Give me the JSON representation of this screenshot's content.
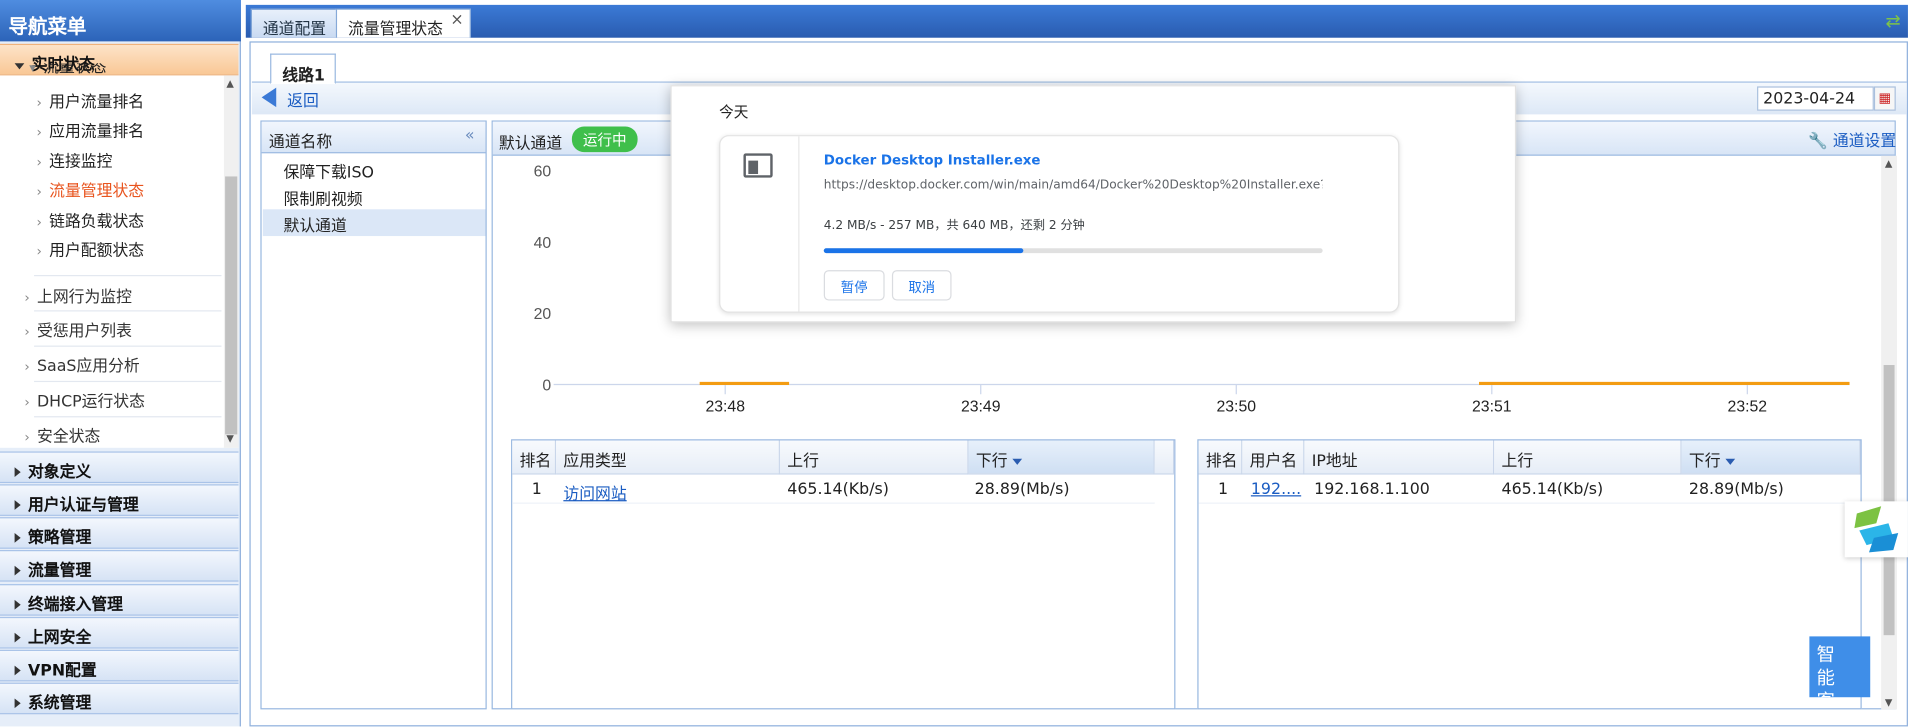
{
  "nav": {
    "title": "导航菜单",
    "collapse_icon": "«",
    "live_group": "实时状态",
    "partial_item": "流量状态",
    "sub_items": [
      "用户流量排名",
      "应用流量排名",
      "连接监控",
      "流量管理状态",
      "链路负载状态",
      "用户配额状态"
    ],
    "active_sub": "流量管理状态",
    "sections": [
      "上网行为监控",
      "受惩用户列表",
      "SaaS应用分析",
      "DHCP运行状态",
      "安全状态"
    ],
    "groups": [
      "对象定义",
      "用户认证与管理",
      "策略管理",
      "流量管理",
      "终端接入管理",
      "上网安全",
      "VPN配置",
      "系统管理"
    ]
  },
  "tabs": {
    "items": [
      "通道配置",
      "流量管理状态"
    ],
    "active": "流量管理状态",
    "close_glyph": "×",
    "refresh_glyph": "⇄"
  },
  "line_tab": "线路1",
  "back_label": "返回",
  "date_value": "2023-04-24",
  "channels": {
    "header": "通道名称",
    "items": [
      "保障下载ISO",
      "限制刷视频",
      "默认通道"
    ],
    "selected": "默认通道"
  },
  "chart_panel": {
    "title": "默认通道",
    "status": "运行中",
    "setting_label": "通道设置"
  },
  "chart_data": {
    "type": "line",
    "x_tick_labels": [
      "23:48",
      "23:49",
      "23:50",
      "23:51",
      "23:52"
    ],
    "y_ticks": [
      0,
      20,
      40,
      60
    ],
    "ylim": [
      0,
      60
    ],
    "series": [
      {
        "color": "#f39c12",
        "x": [
          "23:47.9",
          "23:48.25"
        ],
        "y": [
          0.3,
          0.3
        ]
      },
      {
        "color": "#f39c12",
        "x": [
          "23:50.95",
          "23:52.4"
        ],
        "y": [
          0.3,
          0.3
        ]
      }
    ],
    "grid": false
  },
  "app_table": {
    "headers": [
      "排名",
      "应用类型",
      "上行",
      "下行"
    ],
    "rows": [
      {
        "rank": "1",
        "name": "访问网站",
        "up": "465.14(Kb/s)",
        "down": "28.89(Mb/s)"
      }
    ]
  },
  "user_table": {
    "headers": [
      "排名",
      "用户名",
      "IP地址",
      "上行",
      "下行"
    ],
    "rows": [
      {
        "rank": "1",
        "user": "192....",
        "ip": "192.168.1.100",
        "up": "465.14(Kb/s)",
        "down": "28.89(Mb/s)"
      }
    ]
  },
  "download": {
    "section": "今天",
    "filename": "Docker Desktop Installer.exe",
    "url": "https://desktop.docker.com/win/main/amd64/Docker%20Desktop%20Installer.exe?ut...",
    "status": "4.2 MB/s - 257 MB，共 640 MB，还剩 2 分钟",
    "progress": 0.4,
    "pause_label": "暂停",
    "cancel_label": "取消"
  },
  "assistant": "智能客"
}
